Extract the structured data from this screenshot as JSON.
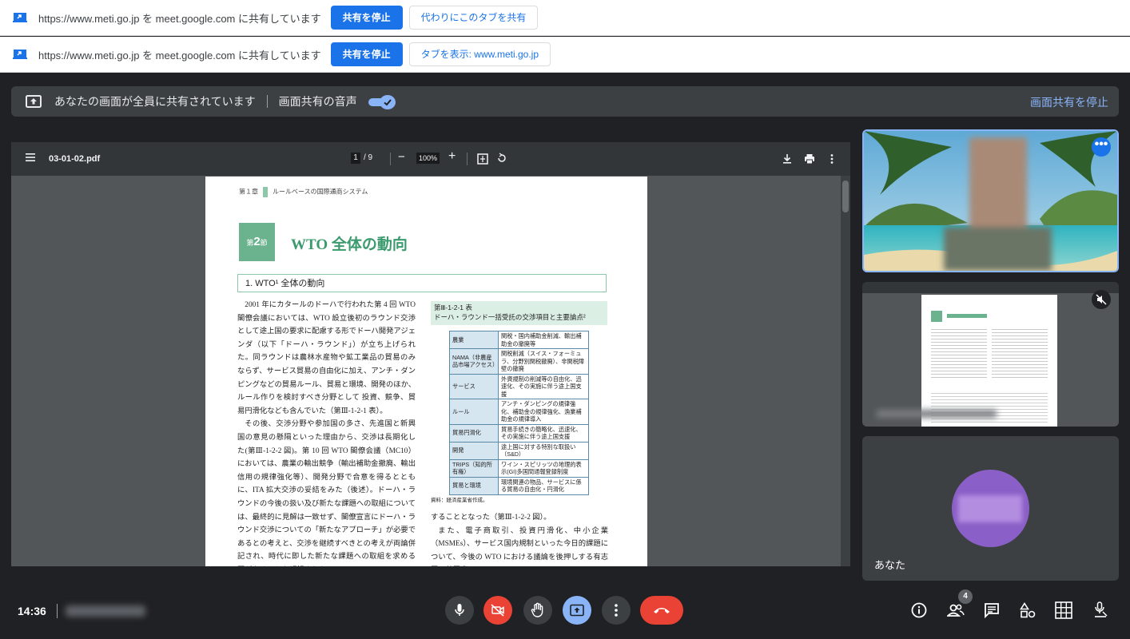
{
  "infobars": [
    {
      "message": "https://www.meti.go.jp を meet.google.com に共有しています",
      "stop_label": "共有を停止",
      "secondary_label": "代わりにこのタブを共有"
    },
    {
      "message": "https://www.meti.go.jp を meet.google.com に共有しています",
      "stop_label": "共有を停止",
      "secondary_label": "タブを表示: www.meti.go.jp"
    }
  ],
  "banner": {
    "message": "あなたの画面が全員に共有されています",
    "audio_label": "画面共有の音声",
    "audio_enabled": true,
    "stop_label": "画面共有を停止"
  },
  "pdf": {
    "filename": "03-01-02.pdf",
    "page_current": "1",
    "page_total": "/ 9",
    "zoom": "100%",
    "page": {
      "chapter": "第１章",
      "chapter_title": "ルールベースの国際通商システム",
      "section_label": "第",
      "section_number": "2",
      "section_suffix": "節",
      "section_title": "WTO 全体の動向",
      "heading": "1.  WTO¹ 全体の動向",
      "col1_paragraphs": [
        "2001 年にカタールのドーハで行われた第 4 回 WTO 閣僚会議においては、WTO 設立後初のラウンド交渉として途上国の要求に配慮する形でドーハ開発アジェンダ（以下「ドーハ・ラウンド」）が立ち上げられた。同ラウンドは農林水産物や鉱工業品の貿易のみならず、サービス貿易の自由化に加え、アンチ・ダンピングなどの貿易ルール、貿易と環境、開発のほか、ルール作りを検討すべき分野として 投資、競争、貿易円滑化なども含んでいた（第Ⅲ-1-2-1 表）。",
        "その後、交渉分野や参加国の多さ、先進国と新興国の意見の懸隔といった理由から、交渉は長期化した(第Ⅲ-1-2-2 図)。第 10 回 WTO 閣僚会議（MC10）においては、農業の輸出競争（輸出補助金撤廃、輸出信用の規律強化等）、開発分野で合意を得るとともに、ITA 拡大交渉の妥結をみた（後述）。ドーハ・ラウンドの今後の扱い及び新たな課題への取組については、最終的に見解は一致せず、閣僚宣言にドーハ・ラウンド交渉についての「新たなアプローチ」が必要であるとの考えと、交渉を継続すべきとの考えが両論併記され、時代に即した新たな課題への取組を求める国があることも明記された。"
      ],
      "table_caption_line1": "第Ⅲ-1-2-1 表",
      "table_caption_line2": "ドーハ・ラウンド一括受託の交渉項目と主要論点²",
      "table_rows": [
        {
          "k": "農業",
          "v": "関税・国内補助金削減、輸出補助金の撤廃等"
        },
        {
          "k": "NAMA（非農産品市場アクセス）",
          "v": "関税削減（スイス・フォーミュラ、分野別関税撤廃）、非関税障壁の撤廃"
        },
        {
          "k": "サービス",
          "v": "外資規制の削減等の自由化、迅速化、その実施に伴う途上国支援"
        },
        {
          "k": "ルール",
          "v": "アンチ・ダンピングの規律強化、補助金の規律強化、漁業補助金の規律導入"
        },
        {
          "k": "貿易円滑化",
          "v": "貿易手続きの簡略化、迅速化、その実施に伴う途上国支援"
        },
        {
          "k": "開発",
          "v": "途上国に対する特別な取扱い（S&D）"
        },
        {
          "k": "TRIPS（知的所有権）",
          "v": "ワイン・スピリッツの地理的表示(GI)多国間通報登録制度"
        },
        {
          "k": "貿易と環境",
          "v": "環境関連の物品、サービスに係る貿易の自由化・円滑化"
        }
      ],
      "source_note": "資料：経済産業省作成。",
      "col2_line1": "することとなった（第Ⅲ-1-2-2 図）。",
      "col2_para": "また、電子商取引、投資円滑化、中小企業（MSMEs）、サービス国内規制といった今日的課題について、今後の WTO における議論を後押しする有志国の共同声"
    }
  },
  "tiles": {
    "self_label": "あなた"
  },
  "bottom_bar": {
    "time": "14:36",
    "participant_count": "4"
  },
  "colors": {
    "background": "#202124",
    "accent": "#8ab4f8",
    "end_call": "#ea4335",
    "primary_button": "#1a73e8"
  },
  "icons": {
    "controls": [
      "mic-icon",
      "camera-off-icon",
      "raise-hand-icon",
      "present-icon",
      "more-vert-icon",
      "end-call-icon"
    ],
    "right": [
      "info-icon",
      "people-icon",
      "chat-icon",
      "activities-icon",
      "grid-icon",
      "host-controls-icon"
    ]
  }
}
